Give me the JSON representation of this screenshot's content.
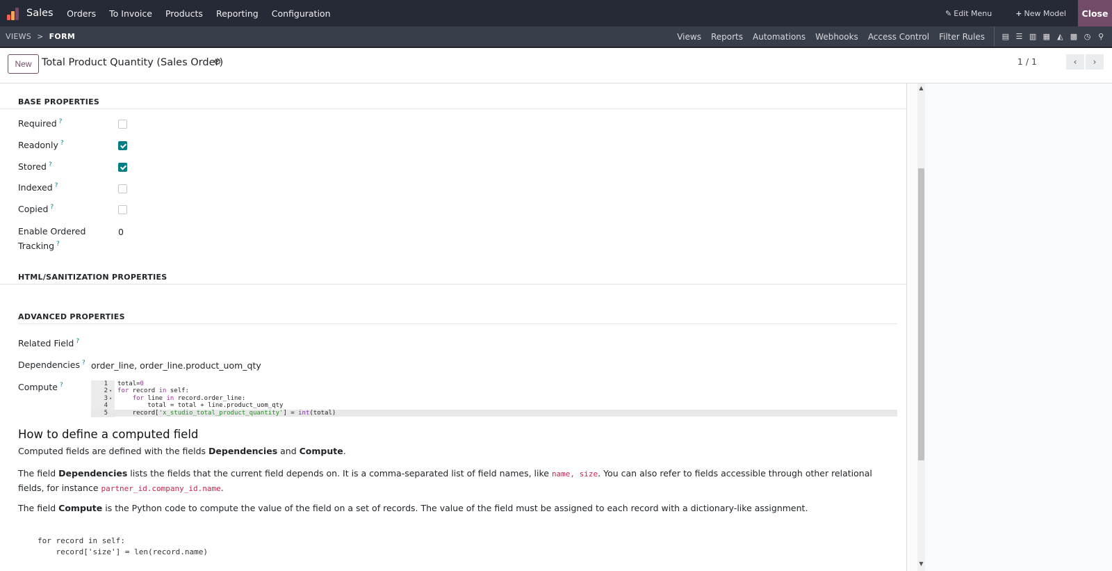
{
  "topbar": {
    "app_name": "Sales",
    "menu": [
      "Orders",
      "To Invoice",
      "Products",
      "Reporting",
      "Configuration"
    ],
    "edit_menu": "Edit Menu",
    "new_model": "New Model",
    "close": "Close",
    "logo_colors": [
      "#f06050",
      "#f4a460",
      "#714b67"
    ]
  },
  "subbar": {
    "breadcrumb_root": "VIEWS",
    "breadcrumb_sep": ">",
    "breadcrumb_current": "FORM",
    "nav": [
      "Views",
      "Reports",
      "Automations",
      "Webhooks",
      "Access Control",
      "Filter Rules"
    ]
  },
  "control": {
    "new_button": "New",
    "title": "Total Product Quantity (Sales Order)",
    "pager": "1 / 1"
  },
  "sections": {
    "base": "BASE PROPERTIES",
    "html": "HTML/SANITIZATION PROPERTIES",
    "advanced": "ADVANCED PROPERTIES"
  },
  "base_fields": {
    "required": {
      "label": "Required",
      "checked": false
    },
    "readonly": {
      "label": "Readonly",
      "checked": true
    },
    "stored": {
      "label": "Stored",
      "checked": true
    },
    "indexed": {
      "label": "Indexed",
      "checked": false
    },
    "copied": {
      "label": "Copied",
      "checked": false
    },
    "tracking": {
      "label_1": "Enable Ordered",
      "label_2": "Tracking",
      "value": "0"
    }
  },
  "advanced_fields": {
    "related_label": "Related Field",
    "dependencies_label": "Dependencies",
    "dependencies_value": "order_line, order_line.product_uom_qty",
    "compute_label": "Compute"
  },
  "code_lines": [
    {
      "n": "1",
      "text": "total=0"
    },
    {
      "n": "2",
      "text": "for record in self:"
    },
    {
      "n": "3",
      "text": "    for line in record.order_line:"
    },
    {
      "n": "4",
      "text": "        total = total + line.product_uom_qty"
    },
    {
      "n": "5",
      "text": "    record['x_studio_total_product_quantity'] = int(total)"
    }
  ],
  "help": {
    "heading": "How to define a computed field",
    "p1_a": "Computed fields are defined with the fields ",
    "p1_b": "Dependencies",
    "p1_c": " and ",
    "p1_d": "Compute",
    "p1_e": ".",
    "p2_a": "The field ",
    "p2_b": "Dependencies",
    "p2_c": " lists the fields that the current field depends on. It is a comma-separated list of field names, like ",
    "p2_d": "name, size",
    "p2_e": ". You can also refer to fields accessible through other relational fields, for instance ",
    "p2_f": "partner_id.company_id.name",
    "p2_g": ".",
    "p3_a": "The field ",
    "p3_b": "Compute",
    "p3_c": " is the Python code to compute the value of the field on a set of records. The value of the field must be assigned to each record with a dictionary-like assignment.",
    "pre_1": "for record in self:",
    "pre_2": "    record['size'] = len(record.name)"
  }
}
